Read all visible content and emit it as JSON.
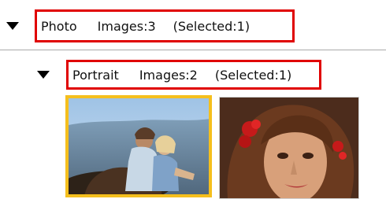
{
  "groups": [
    {
      "name": "Photo",
      "images_label": "Images:3",
      "selected_label": "(Selected:1)",
      "expanded": true
    },
    {
      "name": "Portrait",
      "images_label": "Images:2",
      "selected_label": "(Selected:1)",
      "expanded": true
    }
  ],
  "thumbnails": [
    {
      "subject": "couple-on-horse-photo",
      "selected": true
    },
    {
      "subject": "woman-with-red-flowers-portrait",
      "selected": false
    }
  ],
  "colors": {
    "highlight_box": "#e00000",
    "selection_border": "#f5bf1d",
    "separator": "#aaaaaa"
  },
  "icons": {
    "expander": "triangle-down-icon"
  }
}
